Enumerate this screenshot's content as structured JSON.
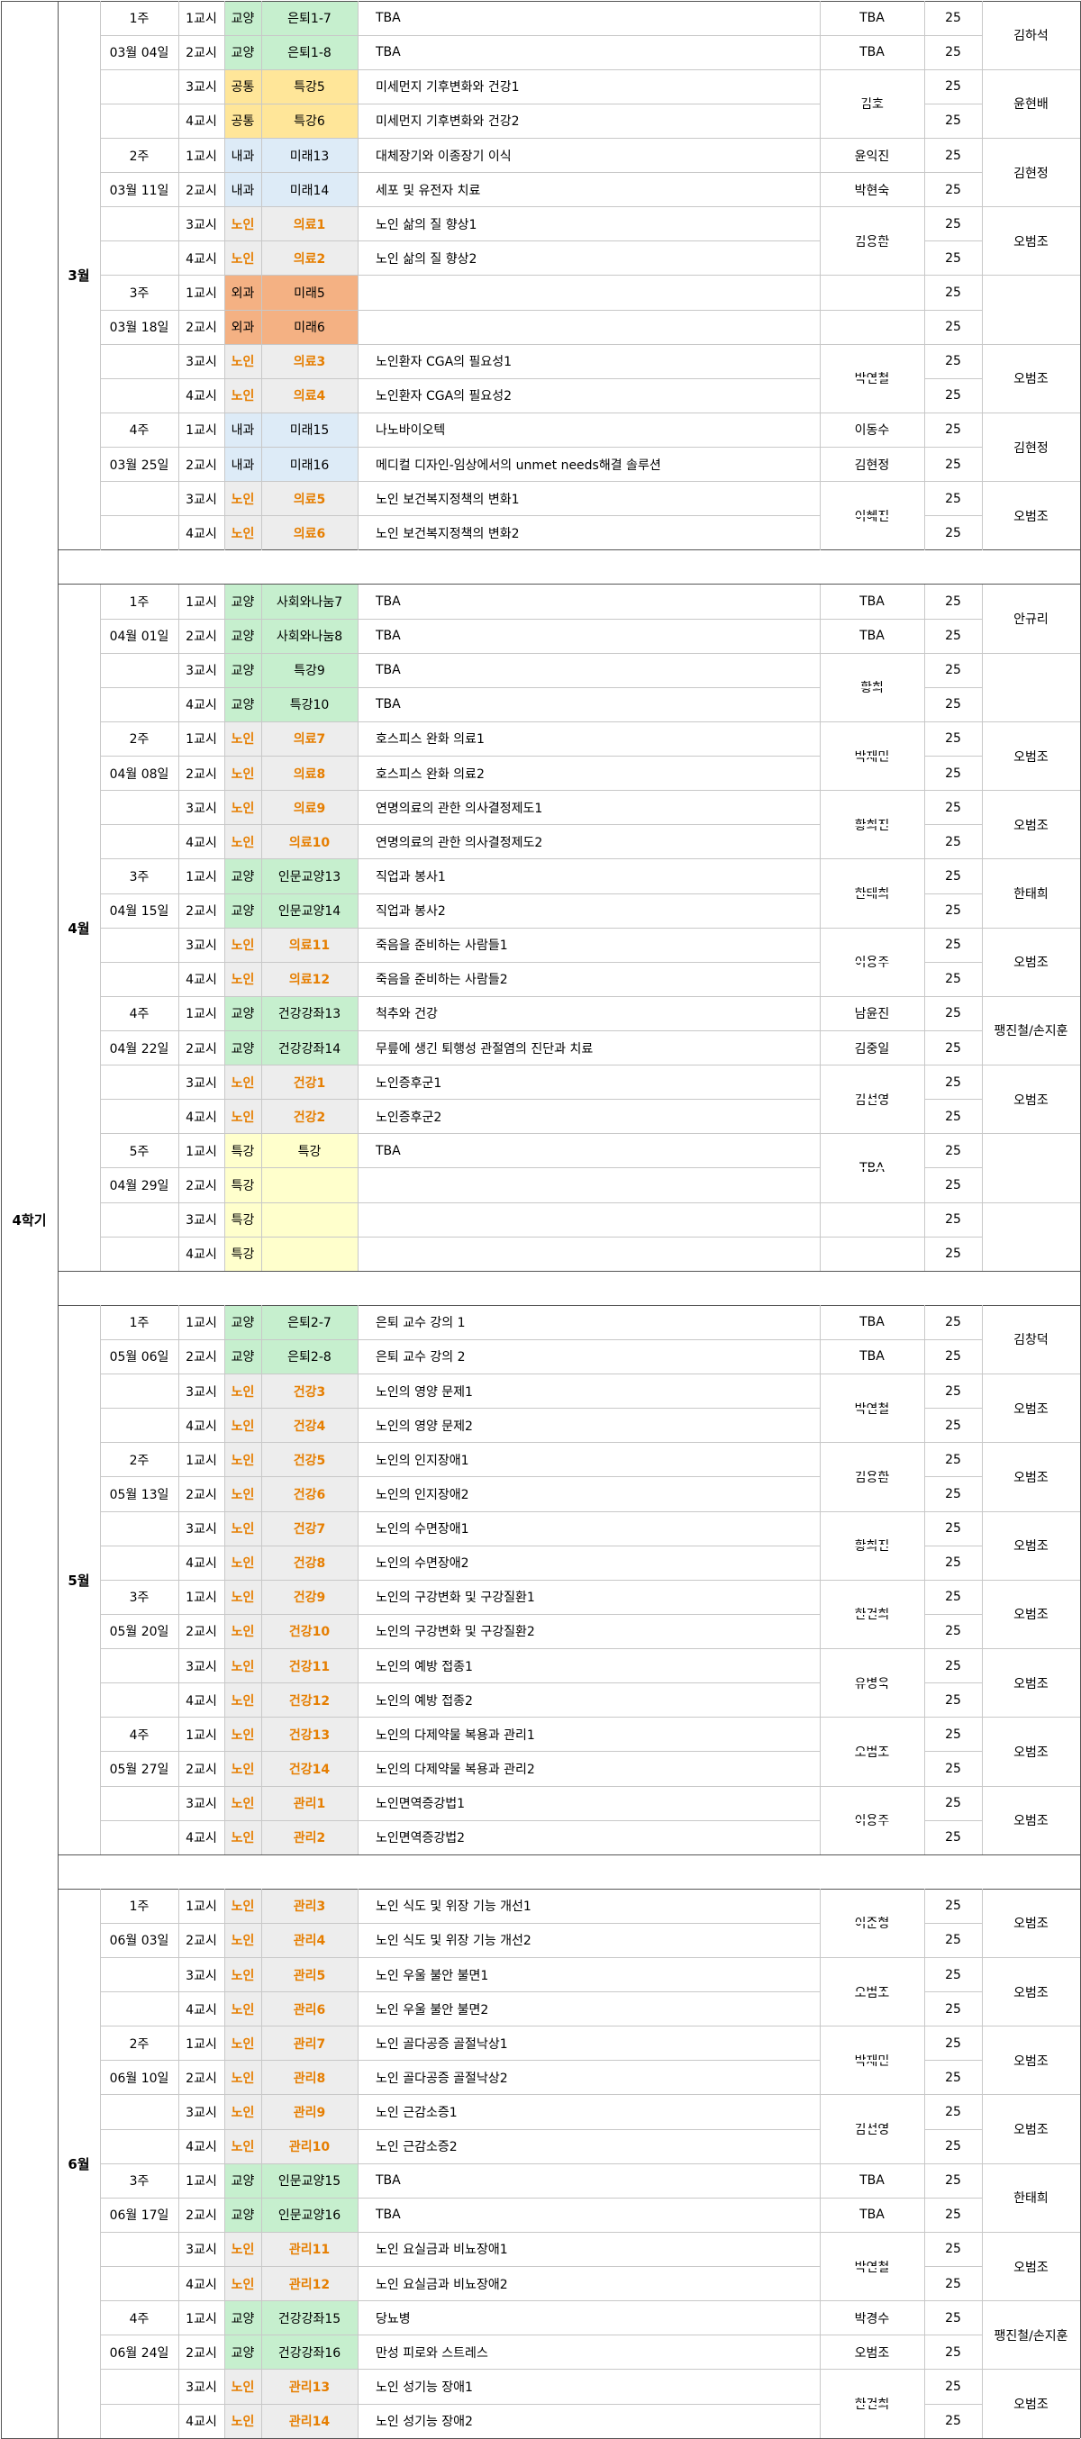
{
  "grade_label": "4학기",
  "colors": {
    "교양": "#c6efce",
    "공통": "#ffe699",
    "내과": "#ddebf7",
    "노인": "#ededed",
    "외과": "#f4b183",
    "특강": "#ffffcc"
  },
  "months": [
    {
      "label": "3월",
      "weeks": [
        {
          "week": "1주",
          "date": "03월 04일"
        },
        {
          "week": "2주",
          "date": "03월 11일"
        },
        {
          "week": "3주",
          "date": "03월 18일"
        },
        {
          "week": "4주",
          "date": "03월 25일"
        }
      ],
      "rows": [
        {
          "period": "1교시",
          "cat": "교양",
          "subj": "은퇴1-7",
          "title": "TBA",
          "prof": "TBA",
          "n": "25"
        },
        {
          "period": "2교시",
          "cat": "교양",
          "subj": "은퇴1-8",
          "title": "TBA",
          "prof": "TBA",
          "n": "25"
        },
        {
          "period": "3교시",
          "cat": "공통",
          "subj": "특강5",
          "title": "미세먼지 기후변화와 건강1",
          "prof": "김호",
          "n": "25"
        },
        {
          "period": "4교시",
          "cat": "공통",
          "subj": "특강6",
          "title": "미세먼지 기후변화와 건강2",
          "prof": "",
          "n": "25"
        },
        {
          "period": "1교시",
          "cat": "내과",
          "subj": "미래13",
          "title": "대체장기와 이종장기 이식",
          "prof": "윤익진",
          "n": "25"
        },
        {
          "period": "2교시",
          "cat": "내과",
          "subj": "미래14",
          "title": "세포 및 유전자 치료",
          "prof": "박현숙",
          "n": "25"
        },
        {
          "period": "3교시",
          "cat": "노인",
          "subj": "의료1",
          "title": "노인 삶의 질 향상1",
          "prof": "김용환",
          "n": "25"
        },
        {
          "period": "4교시",
          "cat": "노인",
          "subj": "의료2",
          "title": "노인 삶의 질 향상2",
          "prof": "",
          "n": "25"
        },
        {
          "period": "1교시",
          "cat": "외과",
          "subj": "미래5",
          "title": "",
          "prof": "",
          "n": "25"
        },
        {
          "period": "2교시",
          "cat": "외과",
          "subj": "미래6",
          "title": "",
          "prof": "",
          "n": "25"
        },
        {
          "period": "3교시",
          "cat": "노인",
          "subj": "의료3",
          "title": "노인환자 CGA의 필요성1",
          "prof": "박연철",
          "n": "25"
        },
        {
          "period": "4교시",
          "cat": "노인",
          "subj": "의료4",
          "title": "노인환자 CGA의 필요성2",
          "prof": "",
          "n": "25"
        },
        {
          "period": "1교시",
          "cat": "내과",
          "subj": "미래15",
          "title": "나노바이오텍",
          "prof": "이동수",
          "n": "25"
        },
        {
          "period": "2교시",
          "cat": "내과",
          "subj": "미래16",
          "title": "메디컬 디자인-임상에서의 unmet needs해결 솔루션",
          "prof": "김현정",
          "n": "25"
        },
        {
          "period": "3교시",
          "cat": "노인",
          "subj": "의료5",
          "title": "노인 보건복지정책의 변화1",
          "prof": "이혜진",
          "n": "25"
        },
        {
          "period": "4교시",
          "cat": "노인",
          "subj": "의료6",
          "title": "노인 보건복지정책의 변화2",
          "prof": "",
          "n": "25"
        }
      ],
      "coords": [
        {
          "name": "김하석"
        },
        {
          "name": "윤현배"
        },
        {
          "name": "김현정"
        },
        {
          "name": "오범조"
        },
        {
          "name": ""
        },
        {
          "name": "오범조"
        },
        {
          "name": "김현정"
        },
        {
          "name": "오범조"
        }
      ]
    },
    {
      "label": "4월",
      "weeks": [
        {
          "week": "1주",
          "date": "04월 01일"
        },
        {
          "week": "2주",
          "date": "04월 08일"
        },
        {
          "week": "3주",
          "date": "04월 15일"
        },
        {
          "week": "4주",
          "date": "04월 22일"
        },
        {
          "week": "5주",
          "date": "04월 29일"
        }
      ],
      "rows": [
        {
          "period": "1교시",
          "cat": "교양",
          "subj": "사회와나눔7",
          "title": "TBA",
          "prof": "TBA",
          "n": "25"
        },
        {
          "period": "2교시",
          "cat": "교양",
          "subj": "사회와나눔8",
          "title": "TBA",
          "prof": "TBA",
          "n": "25"
        },
        {
          "period": "3교시",
          "cat": "교양",
          "subj": "특강9",
          "title": "TBA",
          "prof": "황희",
          "n": "25"
        },
        {
          "period": "4교시",
          "cat": "교양",
          "subj": "특강10",
          "title": "TBA",
          "prof": "",
          "n": "25"
        },
        {
          "period": "1교시",
          "cat": "노인",
          "subj": "의료7",
          "title": "호스피스 완화 의료1",
          "prof": "박재민",
          "n": "25"
        },
        {
          "period": "2교시",
          "cat": "노인",
          "subj": "의료8",
          "title": "호스피스 완화 의료2",
          "prof": "",
          "n": "25"
        },
        {
          "period": "3교시",
          "cat": "노인",
          "subj": "의료9",
          "title": "연명의료의 관한 의사결정제도1",
          "prof": "황희진",
          "n": "25"
        },
        {
          "period": "4교시",
          "cat": "노인",
          "subj": "의료10",
          "title": "연명의료의 관한 의사결정제도2",
          "prof": "",
          "n": "25"
        },
        {
          "period": "1교시",
          "cat": "교양",
          "subj": "인문교양13",
          "title": "직업과 봉사1",
          "prof": "한태희",
          "n": "25"
        },
        {
          "period": "2교시",
          "cat": "교양",
          "subj": "인문교양14",
          "title": "직업과 봉사2",
          "prof": "",
          "n": "25"
        },
        {
          "period": "3교시",
          "cat": "노인",
          "subj": "의료11",
          "title": "죽음을 준비하는 사람들1",
          "prof": "이용주",
          "n": "25"
        },
        {
          "period": "4교시",
          "cat": "노인",
          "subj": "의료12",
          "title": "죽음을 준비하는 사람들2",
          "prof": "",
          "n": "25"
        },
        {
          "period": "1교시",
          "cat": "교양",
          "subj": "건강강좌13",
          "title": "척추와 건강",
          "prof": "남윤진",
          "n": "25"
        },
        {
          "period": "2교시",
          "cat": "교양",
          "subj": "건강강좌14",
          "title": "무릎에 생긴 퇴행성 관절염의 진단과 치료",
          "prof": "김중일",
          "n": "25"
        },
        {
          "period": "3교시",
          "cat": "노인",
          "subj": "건강1",
          "title": "노인증후군1",
          "prof": "김선영",
          "n": "25"
        },
        {
          "period": "4교시",
          "cat": "노인",
          "subj": "건강2",
          "title": "노인증후군2",
          "prof": "",
          "n": "25"
        },
        {
          "period": "1교시",
          "cat": "특강",
          "subj": "특강",
          "title": "TBA",
          "prof": "TBA",
          "n": "25"
        },
        {
          "period": "2교시",
          "cat": "특강",
          "subj": "",
          "title": "",
          "prof": "",
          "n": "25"
        },
        {
          "period": "3교시",
          "cat": "특강",
          "subj": "",
          "title": "",
          "prof": "",
          "n": "25"
        },
        {
          "period": "4교시",
          "cat": "특강",
          "subj": "",
          "title": "",
          "prof": "",
          "n": "25"
        }
      ],
      "coords": [
        {
          "name": "안규리"
        },
        {
          "name": ""
        },
        {
          "name": "오범조"
        },
        {
          "name": "오범조"
        },
        {
          "name": "한태희"
        },
        {
          "name": "오범조"
        },
        {
          "name": "팽진철/손지훈"
        },
        {
          "name": "오범조"
        },
        {
          "name": ""
        },
        {
          "name": ""
        }
      ]
    },
    {
      "label": "5월",
      "weeks": [
        {
          "week": "1주",
          "date": "05월 06일"
        },
        {
          "week": "2주",
          "date": "05월 13일"
        },
        {
          "week": "3주",
          "date": "05월 20일"
        },
        {
          "week": "4주",
          "date": "05월 27일"
        }
      ],
      "rows": [
        {
          "period": "1교시",
          "cat": "교양",
          "subj": "은퇴2-7",
          "title": "은퇴 교수 강의 1",
          "prof": "TBA",
          "n": "25"
        },
        {
          "period": "2교시",
          "cat": "교양",
          "subj": "은퇴2-8",
          "title": "은퇴 교수 강의 2",
          "prof": "TBA",
          "n": "25"
        },
        {
          "period": "3교시",
          "cat": "노인",
          "subj": "건강3",
          "title": "노인의 영양 문제1",
          "prof": "박연철",
          "n": "25"
        },
        {
          "period": "4교시",
          "cat": "노인",
          "subj": "건강4",
          "title": "노인의 영양 문제2",
          "prof": "",
          "n": "25"
        },
        {
          "period": "1교시",
          "cat": "노인",
          "subj": "건강5",
          "title": "노인의 인지장애1",
          "prof": "김용환",
          "n": "25"
        },
        {
          "period": "2교시",
          "cat": "노인",
          "subj": "건강6",
          "title": "노인의 인지장애2",
          "prof": "",
          "n": "25"
        },
        {
          "period": "3교시",
          "cat": "노인",
          "subj": "건강7",
          "title": "노인의 수면장애1",
          "prof": "황희진",
          "n": "25"
        },
        {
          "period": "4교시",
          "cat": "노인",
          "subj": "건강8",
          "title": "노인의 수면장애2",
          "prof": "",
          "n": "25"
        },
        {
          "period": "1교시",
          "cat": "노인",
          "subj": "건강9",
          "title": "노인의 구강변화 및 구강질환1",
          "prof": "한건희",
          "n": "25"
        },
        {
          "period": "2교시",
          "cat": "노인",
          "subj": "건강10",
          "title": "노인의 구강변화 및 구강질환2",
          "prof": "",
          "n": "25"
        },
        {
          "period": "3교시",
          "cat": "노인",
          "subj": "건강11",
          "title": "노인의 예방 접종1",
          "prof": "유병욱",
          "n": "25"
        },
        {
          "period": "4교시",
          "cat": "노인",
          "subj": "건강12",
          "title": "노인의 예방 접종2",
          "prof": "",
          "n": "25"
        },
        {
          "period": "1교시",
          "cat": "노인",
          "subj": "건강13",
          "title": "노인의 다제약물 복용과 관리1",
          "prof": "오범조",
          "n": "25"
        },
        {
          "period": "2교시",
          "cat": "노인",
          "subj": "건강14",
          "title": "노인의 다제약물 복용과 관리2",
          "prof": "",
          "n": "25"
        },
        {
          "period": "3교시",
          "cat": "노인",
          "subj": "관리1",
          "title": "노인면역증강법1",
          "prof": "이용주",
          "n": "25"
        },
        {
          "period": "4교시",
          "cat": "노인",
          "subj": "관리2",
          "title": "노인면역증강법2",
          "prof": "",
          "n": "25"
        }
      ],
      "coords": [
        {
          "name": "김창덕"
        },
        {
          "name": "오범조"
        },
        {
          "name": "오범조"
        },
        {
          "name": "오범조"
        },
        {
          "name": "오범조"
        },
        {
          "name": "오범조"
        },
        {
          "name": "오범조"
        },
        {
          "name": "오범조"
        }
      ]
    },
    {
      "label": "6월",
      "weeks": [
        {
          "week": "1주",
          "date": "06월 03일"
        },
        {
          "week": "2주",
          "date": "06월 10일"
        },
        {
          "week": "3주",
          "date": "06월 17일"
        },
        {
          "week": "4주",
          "date": "06월 24일"
        }
      ],
      "rows": [
        {
          "period": "1교시",
          "cat": "노인",
          "subj": "관리3",
          "title": "노인 식도 및 위장 기능 개선1",
          "prof": "이준형",
          "n": "25"
        },
        {
          "period": "2교시",
          "cat": "노인",
          "subj": "관리4",
          "title": "노인 식도 및 위장 기능 개선2",
          "prof": "",
          "n": "25"
        },
        {
          "period": "3교시",
          "cat": "노인",
          "subj": "관리5",
          "title": "노인 우울 불안 불면1",
          "prof": "오범조",
          "n": "25"
        },
        {
          "period": "4교시",
          "cat": "노인",
          "subj": "관리6",
          "title": "노인 우울 불안 불면2",
          "prof": "",
          "n": "25"
        },
        {
          "period": "1교시",
          "cat": "노인",
          "subj": "관리7",
          "title": "노인 골다공증 골절낙상1",
          "prof": "박재민",
          "n": "25"
        },
        {
          "period": "2교시",
          "cat": "노인",
          "subj": "관리8",
          "title": "노인 골다공증 골절낙상2",
          "prof": "",
          "n": "25"
        },
        {
          "period": "3교시",
          "cat": "노인",
          "subj": "관리9",
          "title": "노인 근감소증1",
          "prof": "김선영",
          "n": "25"
        },
        {
          "period": "4교시",
          "cat": "노인",
          "subj": "관리10",
          "title": "노인 근감소증2",
          "prof": "",
          "n": "25"
        },
        {
          "period": "1교시",
          "cat": "교양",
          "subj": "인문교양15",
          "title": "TBA",
          "prof": "TBA",
          "n": "25"
        },
        {
          "period": "2교시",
          "cat": "교양",
          "subj": "인문교양16",
          "title": "TBA",
          "prof": "TBA",
          "n": "25"
        },
        {
          "period": "3교시",
          "cat": "노인",
          "subj": "관리11",
          "title": "노인 요실금과 비뇨장애1",
          "prof": "박연철",
          "n": "25"
        },
        {
          "period": "4교시",
          "cat": "노인",
          "subj": "관리12",
          "title": "노인 요실금과 비뇨장애2",
          "prof": "",
          "n": "25"
        },
        {
          "period": "1교시",
          "cat": "교양",
          "subj": "건강강좌15",
          "title": "당뇨병",
          "prof": "박경수",
          "n": "25"
        },
        {
          "period": "2교시",
          "cat": "교양",
          "subj": "건강강좌16",
          "title": "만성 피로와 스트레스",
          "prof": "오범조",
          "n": "25"
        },
        {
          "period": "3교시",
          "cat": "노인",
          "subj": "관리13",
          "title": "노인 성기능 장애1",
          "prof": "한건희",
          "n": "25"
        },
        {
          "period": "4교시",
          "cat": "노인",
          "subj": "관리14",
          "title": "노인 성기능 장애2",
          "prof": "",
          "n": "25"
        }
      ],
      "coords": [
        {
          "name": "오범조"
        },
        {
          "name": "오범조"
        },
        {
          "name": "오범조"
        },
        {
          "name": "오범조"
        },
        {
          "name": "한태희"
        },
        {
          "name": "오범조"
        },
        {
          "name": "팽진철/손지훈"
        },
        {
          "name": "오범조"
        }
      ]
    }
  ]
}
